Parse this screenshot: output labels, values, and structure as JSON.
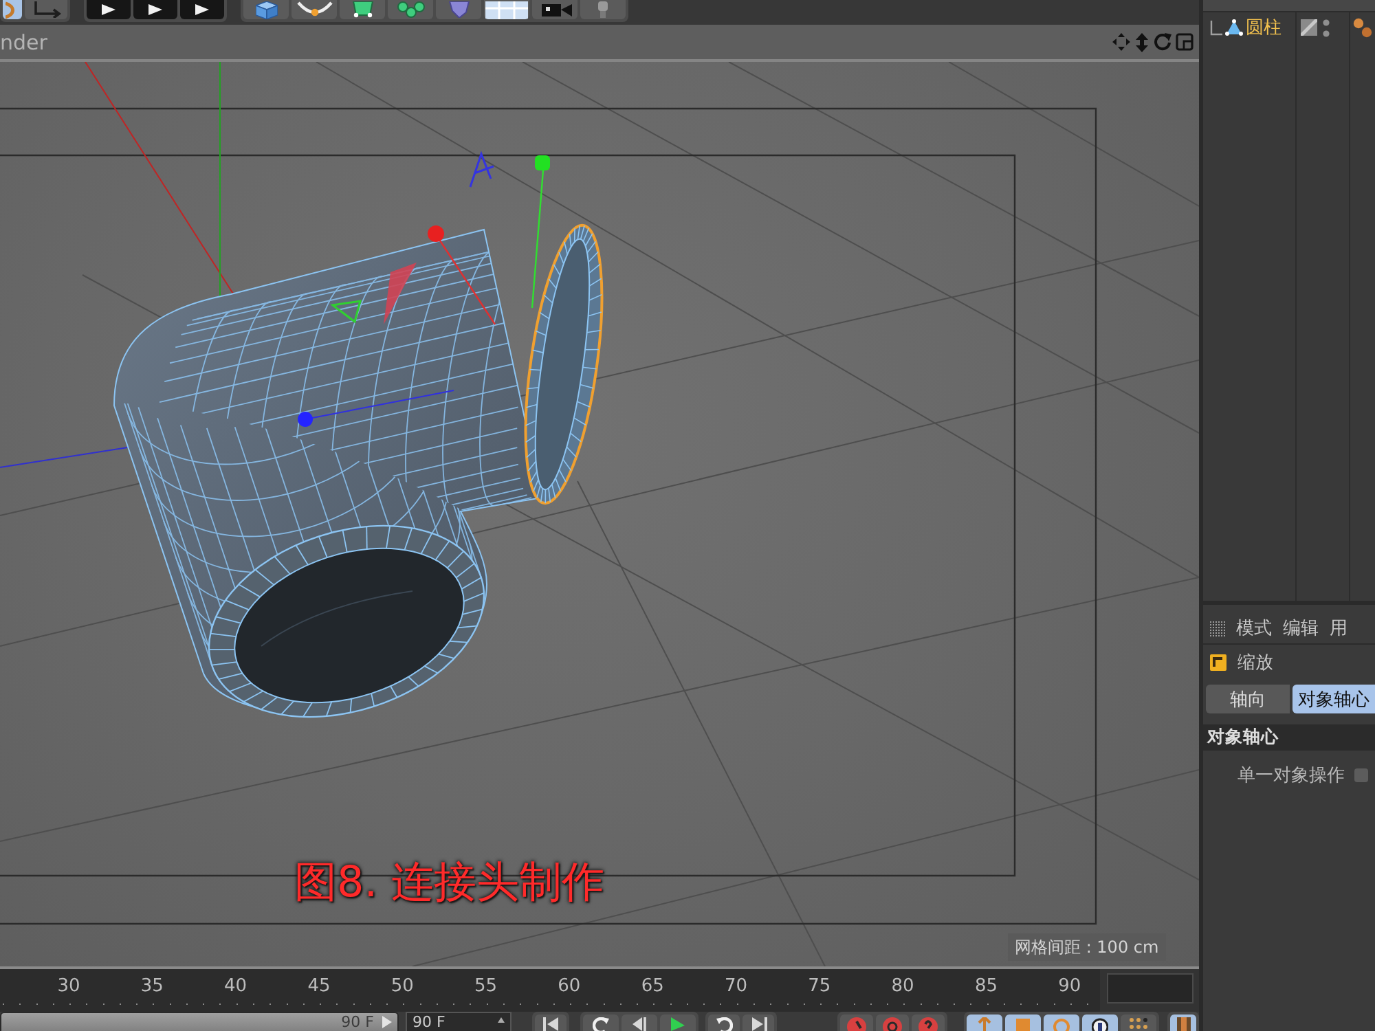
{
  "toolbar": {
    "buttons": [
      {
        "selected": true
      },
      {
        "selected": false
      },
      {
        "selected": false
      },
      {
        "selected": false
      },
      {
        "selected": false
      },
      {
        "selected": false
      },
      {
        "selected": false
      },
      {
        "selected": false
      },
      {
        "selected": false
      },
      {
        "selected": false
      },
      {
        "selected": false
      },
      {
        "selected": false
      },
      {
        "selected": false
      }
    ]
  },
  "viewport": {
    "menu": [
      "nder"
    ],
    "caption": "图8. 连接头制作",
    "grid_spacing": "网格间距 : 100 cm"
  },
  "timeline": {
    "ticks": [
      "30",
      "35",
      "40",
      "45",
      "50",
      "55",
      "60",
      "65",
      "70",
      "75",
      "80",
      "85",
      "90"
    ]
  },
  "playback": {
    "range_slider": {
      "value": "90 F",
      "level": 1
    },
    "frame_field": "90 F",
    "tools": [
      {
        "selected": true
      },
      {
        "selected": true
      },
      {
        "selected": true
      },
      {
        "selected": true
      },
      {
        "selected": false
      },
      {
        "selected": true
      }
    ]
  },
  "object_manager": {
    "objects": [
      {
        "name": "圆柱",
        "selected": true
      }
    ]
  },
  "attributes": {
    "menu": [
      "模式",
      "编辑",
      "用"
    ],
    "title": "缩放",
    "tabs": [
      {
        "label": "轴向",
        "selected": false
      },
      {
        "label": "对象轴心",
        "selected": true
      }
    ],
    "section": "对象轴心",
    "fields": [
      {
        "label": "单一对象操作",
        "checked": false
      }
    ]
  }
}
